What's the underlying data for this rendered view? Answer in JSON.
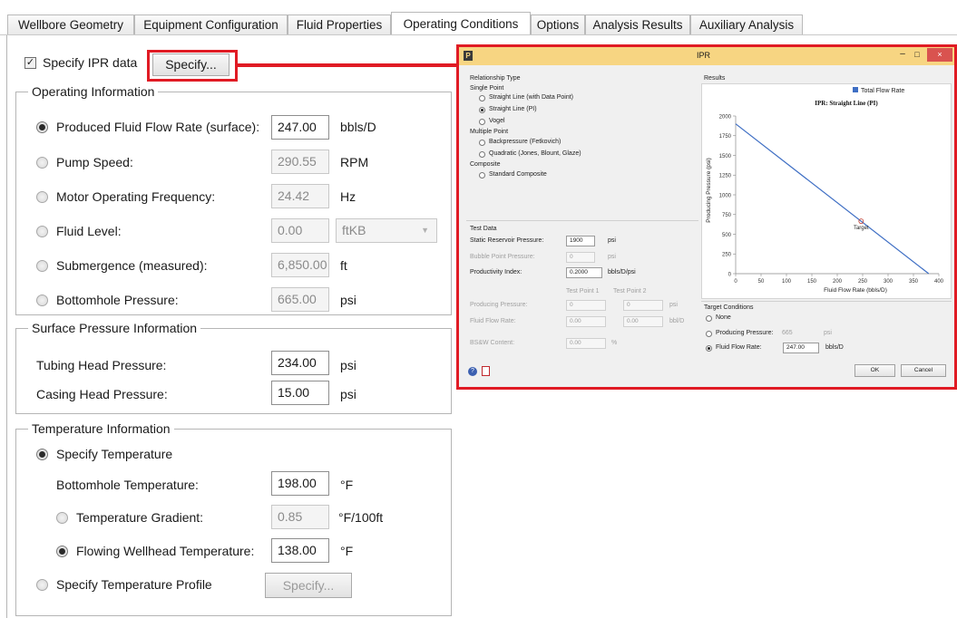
{
  "tabs": [
    {
      "label": "Wellbore Geometry"
    },
    {
      "label": "Equipment Configuration"
    },
    {
      "label": "Fluid Properties"
    },
    {
      "label": "Operating Conditions"
    },
    {
      "label": "Options"
    },
    {
      "label": "Analysis Results"
    },
    {
      "label": "Auxiliary Analysis"
    }
  ],
  "ipr": {
    "checkbox_label": "Specify IPR data",
    "checked": true,
    "specify_label": "Specify..."
  },
  "operating": {
    "title": "Operating Information",
    "rows": [
      {
        "label": "Produced Fluid Flow Rate (surface):",
        "value": "247.00",
        "unit": "bbls/D",
        "selected": true
      },
      {
        "label": "Pump Speed:",
        "value": "290.55",
        "unit": "RPM"
      },
      {
        "label": "Motor Operating Frequency:",
        "value": "24.42",
        "unit": "Hz"
      },
      {
        "label": "Fluid Level:",
        "value": "0.00",
        "unit": "ftKB"
      },
      {
        "label": "Submergence (measured):",
        "value": "6,850.00",
        "unit": "ft"
      },
      {
        "label": "Bottomhole Pressure:",
        "value": "665.00",
        "unit": "psi"
      }
    ]
  },
  "surface": {
    "title": "Surface Pressure Information",
    "rows": [
      {
        "label": "Tubing Head Pressure:",
        "value": "234.00",
        "unit": "psi"
      },
      {
        "label": "Casing Head Pressure:",
        "value": "15.00",
        "unit": "psi"
      }
    ]
  },
  "temperature": {
    "title": "Temperature Information",
    "specify_temp": "Specify Temperature",
    "bottomhole_label": "Bottomhole Temperature:",
    "bottomhole_value": "198.00",
    "bottomhole_unit": "°F",
    "gradient_label": "Temperature Gradient:",
    "gradient_value": "0.85",
    "gradient_unit": "°F/100ft",
    "wellhead_label": "Flowing Wellhead Temperature:",
    "wellhead_value": "138.00",
    "wellhead_unit": "°F",
    "profile_label": "Specify Temperature Profile",
    "profile_button": "Specify..."
  },
  "dialog": {
    "title": "IPR",
    "relationship_title": "Relationship Type",
    "single_point": "Single Point",
    "opt_straight_dp": "Straight Line (with Data Point)",
    "opt_straight_pi": "Straight Line (PI)",
    "opt_vogel": "Vogel",
    "multiple_point": "Multiple Point",
    "opt_backpressure": "Backpressure (Fetkovich)",
    "opt_quadratic": "Quadratic (Jones, Blount, Glaze)",
    "composite": "Composite",
    "opt_standard": "Standard Composite",
    "test_data": "Test Data",
    "static_label": "Static Reservoir Pressure:",
    "static_value": "1900",
    "static_unit": "psi",
    "bubble_label": "Bubble Point Pressure:",
    "bubble_value": "0",
    "bubble_unit": "psi",
    "pi_label": "Productivity Index:",
    "pi_value": "0.2000",
    "pi_unit": "bbls/D/psi",
    "tp1": "Test Point 1",
    "tp2": "Test Point 2",
    "prod_label": "Producing Pressure:",
    "prod_v1": "0",
    "prod_v2": "0",
    "prod_unit": "psi",
    "flow_label": "Fluid Flow Rate:",
    "flow_v1": "0.00",
    "flow_v2": "0.00",
    "flow_unit": "bbl/D",
    "bsw_label": "BS&W Content:",
    "bsw_v": "0.00",
    "bsw_unit": "%",
    "results": "Results",
    "target_title": "Target Conditions",
    "t_none": "None",
    "t_prod_label": "Producing Pressure:",
    "t_prod_value": "665",
    "t_prod_unit": "psi",
    "t_flow_label": "Fluid Flow Rate:",
    "t_flow_value": "247.00",
    "t_flow_unit": "bbls/D",
    "ok": "OK",
    "cancel": "Cancel"
  },
  "chart_data": {
    "type": "line",
    "title": "IPR: Straight Line (PI)",
    "xlabel": "Fluid Flow Rate (bbls/D)",
    "ylabel": "Producing Pressure (psi)",
    "xlim": [
      0,
      400
    ],
    "ylim": [
      0,
      2000
    ],
    "xticks": [
      0,
      50,
      100,
      150,
      200,
      250,
      300,
      350,
      400
    ],
    "yticks": [
      0,
      250,
      500,
      750,
      1000,
      1250,
      1500,
      1750,
      2000
    ],
    "legend_position": "top-right",
    "series": [
      {
        "name": "Total Flow Rate",
        "color": "#3f6fc4",
        "x": [
          0,
          380
        ],
        "y": [
          1900,
          0
        ]
      }
    ],
    "target": {
      "label": "Target",
      "x": 247,
      "y": 665
    }
  }
}
